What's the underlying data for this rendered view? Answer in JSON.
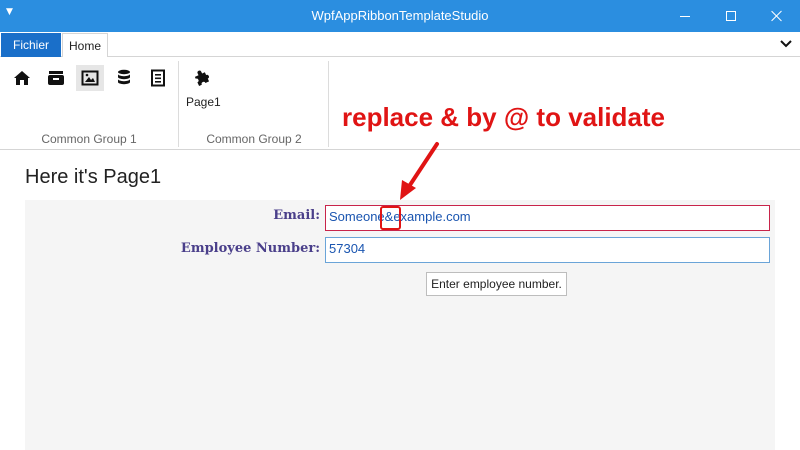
{
  "window": {
    "title": "WpfAppRibbonTemplateStudio"
  },
  "ribbon": {
    "file_tab": "Fichier",
    "home_tab": "Home",
    "group1_label": "Common Group 1",
    "group2_label": "Common Group 2",
    "page1_button_label": "Page1",
    "group1_icons": [
      "home-icon",
      "archive-icon",
      "image-icon",
      "database-icon",
      "document-icon"
    ],
    "group2_icons": [
      "puzzle-icon"
    ]
  },
  "content": {
    "page_title": "Here it's Page1",
    "email_label": "Email:",
    "email_value": "Someone&example.com",
    "employee_label": "Employee Number:",
    "employee_value": "57304",
    "tooltip": "Enter employee number."
  },
  "annotation": {
    "text": "replace & by @ to validate",
    "color": "#e01414"
  },
  "colors": {
    "titlebar": "#2b8ee0",
    "file_tab": "#1a6fc9",
    "error_border": "#c8244a"
  }
}
